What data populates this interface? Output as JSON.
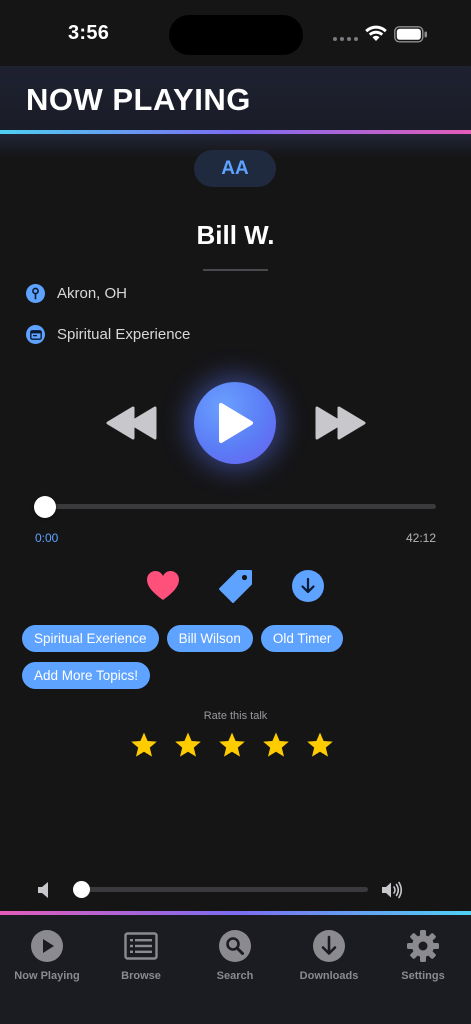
{
  "status_bar": {
    "time": "3:56"
  },
  "header": {
    "title": "NOW PLAYING"
  },
  "font_size_button": {
    "label": "AA"
  },
  "talk": {
    "speaker": "Bill W.",
    "location": "Akron, OH",
    "category": "Spiritual Experience"
  },
  "player": {
    "elapsed": "0:00",
    "duration": "42:12",
    "progress_fraction": 0.0
  },
  "topics": {
    "chips": [
      "Spiritual Exerience",
      "Bill Wilson",
      "Old Timer"
    ],
    "add_label": "Add More Topics!"
  },
  "rating": {
    "label": "Rate this talk",
    "max_stars": 5
  },
  "volume": {
    "level_fraction": 0.0
  },
  "tabs": [
    {
      "label": "Now Playing",
      "icon": "play-circle-icon"
    },
    {
      "label": "Browse",
      "icon": "list-icon"
    },
    {
      "label": "Search",
      "icon": "search-icon"
    },
    {
      "label": "Downloads",
      "icon": "download-icon"
    },
    {
      "label": "Settings",
      "icon": "gear-icon"
    }
  ],
  "colors": {
    "accent": "#5ea3ff",
    "heart": "#ff4f7b",
    "star": "#ffcc00",
    "background": "#151516"
  }
}
